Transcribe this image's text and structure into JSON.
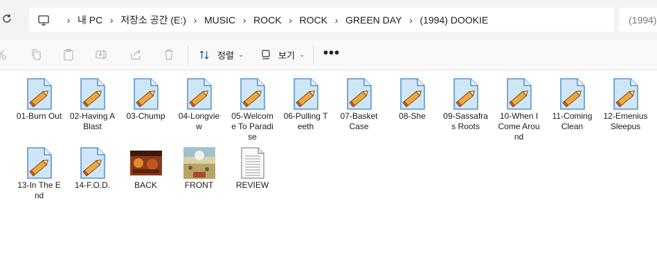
{
  "address_bar": {
    "crumbs": [
      "내 PC",
      "저장소 공간 (E:)",
      "MUSIC",
      "ROCK",
      "ROCK",
      "GREEN DAY",
      "(1994) DOOKIE"
    ],
    "search_placeholder": "(1994)"
  },
  "toolbar": {
    "sort_label": "정렬",
    "view_label": "보기",
    "more_label": "•••"
  },
  "files": [
    {
      "name": "01-Burn Out",
      "kind": "audio"
    },
    {
      "name": "02-Having A Blast",
      "kind": "audio"
    },
    {
      "name": "03-Chump",
      "kind": "audio"
    },
    {
      "name": "04-Longview",
      "kind": "audio"
    },
    {
      "name": "05-Welcome To Paradise",
      "kind": "audio"
    },
    {
      "name": "06-Pulling Teeth",
      "kind": "audio"
    },
    {
      "name": "07-Basket Case",
      "kind": "audio"
    },
    {
      "name": "08-She",
      "kind": "audio"
    },
    {
      "name": "09-Sassafras Roots",
      "kind": "audio"
    },
    {
      "name": "10-When I Come Around",
      "kind": "audio"
    },
    {
      "name": "11-Coming Clean",
      "kind": "audio"
    },
    {
      "name": "12-Emenius Sleepus",
      "kind": "audio"
    },
    {
      "name": "13-In The End",
      "kind": "audio"
    },
    {
      "name": "14-F.O.D.",
      "kind": "audio"
    },
    {
      "name": "BACK",
      "kind": "image-back"
    },
    {
      "name": "FRONT",
      "kind": "image-front"
    },
    {
      "name": "REVIEW",
      "kind": "text"
    }
  ],
  "colors": {
    "audio_icon_fill": "#cfe6f8",
    "audio_icon_stroke": "#3b7fc4",
    "pencil_orange": "#f2a93b"
  }
}
